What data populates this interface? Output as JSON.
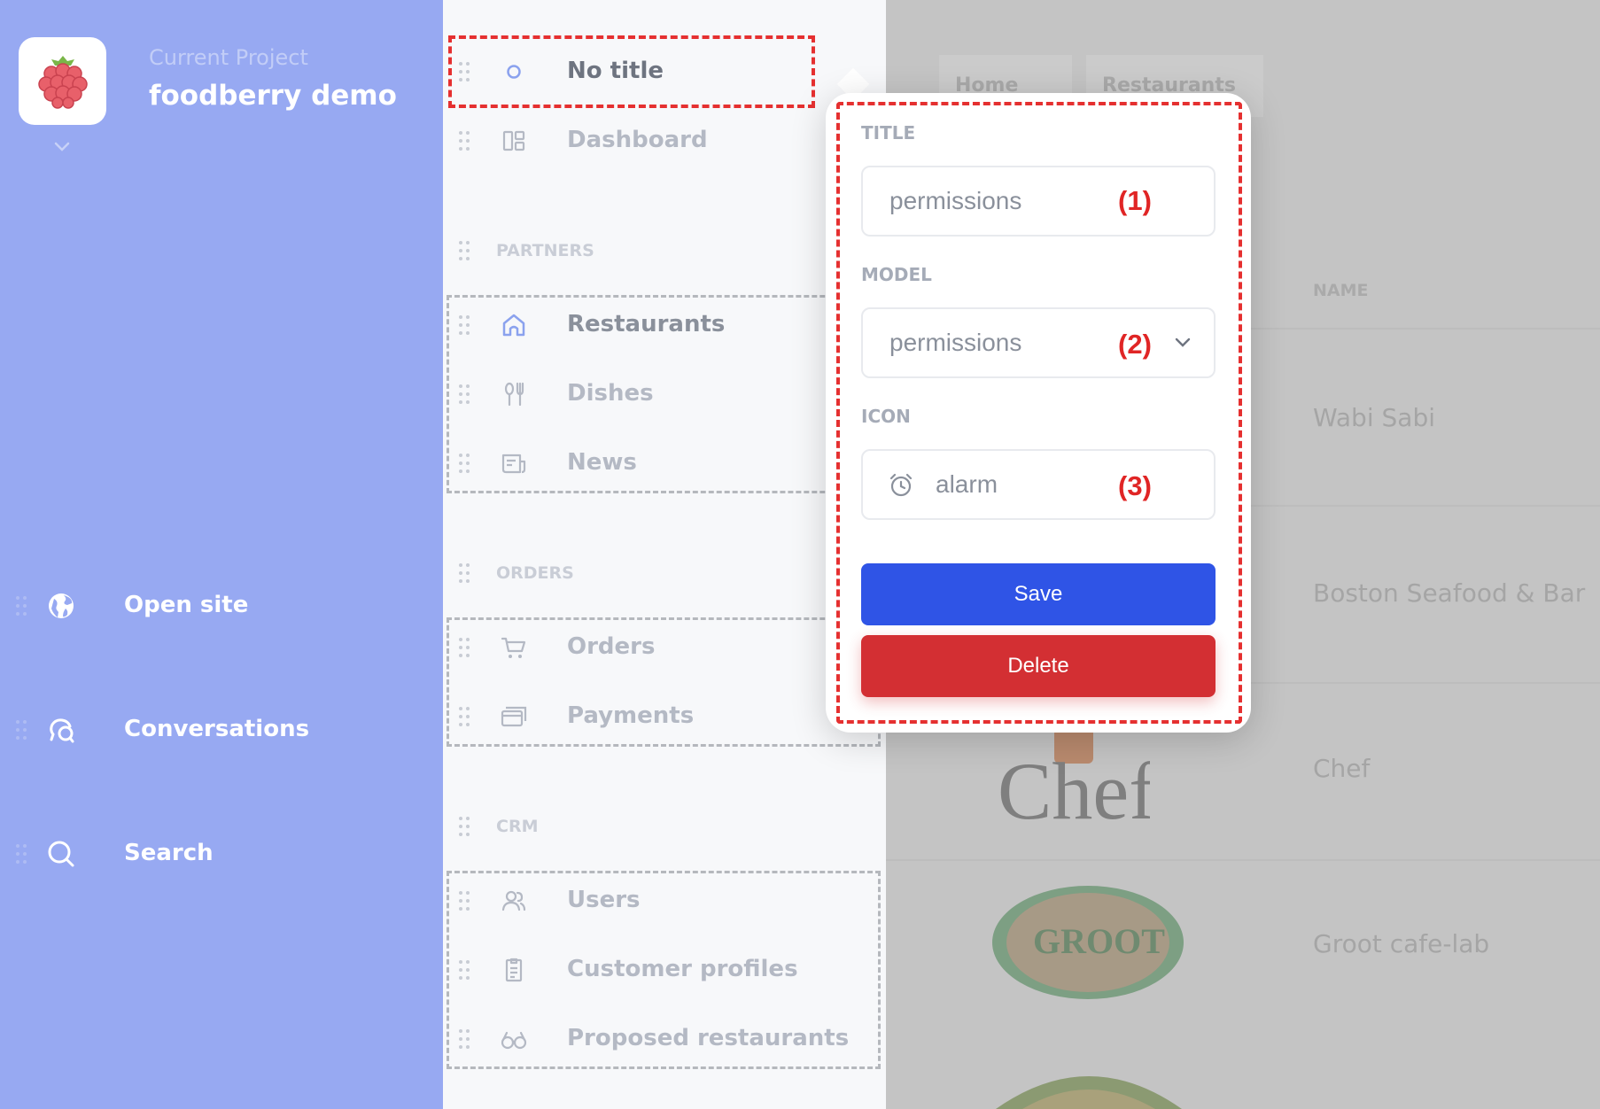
{
  "project": {
    "current_label": "Current Project",
    "name": "foodberry demo"
  },
  "sidebar": {
    "items": [
      {
        "label": "Open site",
        "icon": "globe-icon"
      },
      {
        "label": "Conversations",
        "icon": "chat-bubbles-icon"
      },
      {
        "label": "Search",
        "icon": "search-icon"
      }
    ]
  },
  "nav": {
    "top_items": [
      {
        "label": "No title",
        "icon": "circle-icon"
      },
      {
        "label": "Dashboard",
        "icon": "dashboard-icon"
      }
    ],
    "sections": [
      {
        "title": "PARTNERS",
        "items": [
          {
            "label": "Restaurants",
            "icon": "store-icon"
          },
          {
            "label": "Dishes",
            "icon": "cutlery-icon"
          },
          {
            "label": "News",
            "icon": "newspaper-icon"
          }
        ]
      },
      {
        "title": "ORDERS",
        "items": [
          {
            "label": "Orders",
            "icon": "cart-icon"
          },
          {
            "label": "Payments",
            "icon": "card-icon"
          }
        ]
      },
      {
        "title": "CRM",
        "items": [
          {
            "label": "Users",
            "icon": "users-icon"
          },
          {
            "label": "Customer profiles",
            "icon": "clipboard-icon"
          },
          {
            "label": "Proposed restaurants",
            "icon": "glasses-icon"
          }
        ]
      }
    ]
  },
  "background": {
    "breadcrumb": [
      "Home",
      "Restaurants"
    ],
    "column_header": "NAME",
    "restaurants": [
      "Wabi Sabi",
      "Boston Seafood & Bar",
      "Chef",
      "Groot cafe-lab"
    ],
    "logo_texts": [
      "Chef",
      "GROOT"
    ]
  },
  "popover": {
    "title_label": "TITLE",
    "title_value": "permissions",
    "model_label": "MODEL",
    "model_value": "permissions",
    "icon_label": "ICON",
    "icon_value": "alarm",
    "icon_glyph": "alarm-clock-icon",
    "save_label": "Save",
    "delete_label": "Delete"
  },
  "annotations": [
    "(1)",
    "(2)",
    "(3)"
  ],
  "colors": {
    "sidebar_bg": "#97a9f2",
    "save_button": "#2f54e6",
    "delete_button": "#d32f33",
    "annotation_red": "#e02525"
  }
}
